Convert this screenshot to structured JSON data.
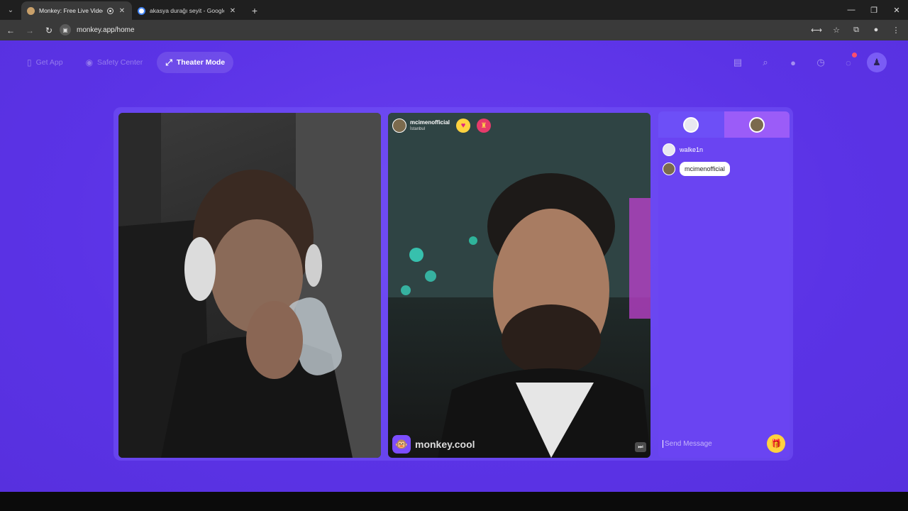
{
  "browser": {
    "tabs": [
      {
        "title": "Monkey: Free Live Video Ch",
        "active": true,
        "recording": true
      },
      {
        "title": "akasya durağı seyit - Google'da",
        "active": false,
        "recording": false
      }
    ],
    "url": "monkey.app/home"
  },
  "topnav": {
    "get_app": "Get App",
    "safety_center": "Safety Center",
    "theater_mode": "Theater Mode"
  },
  "remote_user": {
    "name": "mcimenofficial",
    "location": "İstanbul"
  },
  "watermark": {
    "text": "monkey.cool"
  },
  "chat": {
    "messages": [
      {
        "name": "walke1n",
        "style": "plain"
      },
      {
        "name": "mcimenofficial",
        "style": "bubble"
      }
    ],
    "placeholder": "Send Message"
  },
  "colors": {
    "page_bg": "#5b33e6",
    "chat_bg": "#6a44f2",
    "accent_yellow": "#ffd23f"
  }
}
